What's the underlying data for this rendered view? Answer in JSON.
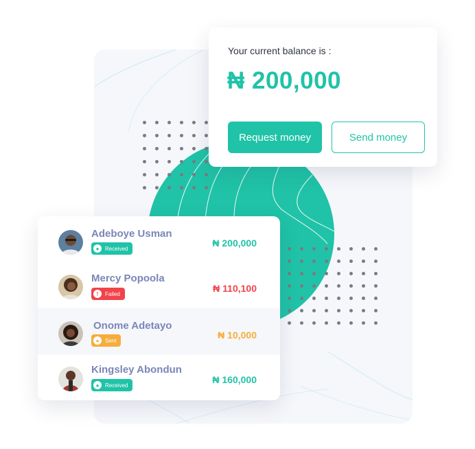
{
  "balance": {
    "label": "Your current balance is :",
    "amount": "₦ 200,000",
    "request_button": "Request money",
    "send_button": "Send money"
  },
  "transactions": [
    {
      "name": "Adeboye Usman",
      "status": "Received",
      "status_icon": "person-icon",
      "amount": "₦ 200,000",
      "color": "#20c3a7"
    },
    {
      "name": "Mercy Popoola",
      "status": "Failed",
      "status_icon": "exclamation-icon",
      "amount": "₦ 110,100",
      "color": "#f0444c"
    },
    {
      "name": "Onome Adetayo",
      "status": "Sent",
      "status_icon": "person-icon",
      "amount": "₦ 10,000",
      "color": "#f6ad3b"
    },
    {
      "name": "Kingsley Abondun",
      "status": "Received",
      "status_icon": "person-icon",
      "amount": "₦ 160,000",
      "color": "#20c3a7"
    }
  ],
  "colors": {
    "accent": "#20c3a7",
    "failed": "#f0444c",
    "sent": "#f6ad3b",
    "name_text": "#7a86b8",
    "panel_bg": "#f6f7fb"
  }
}
